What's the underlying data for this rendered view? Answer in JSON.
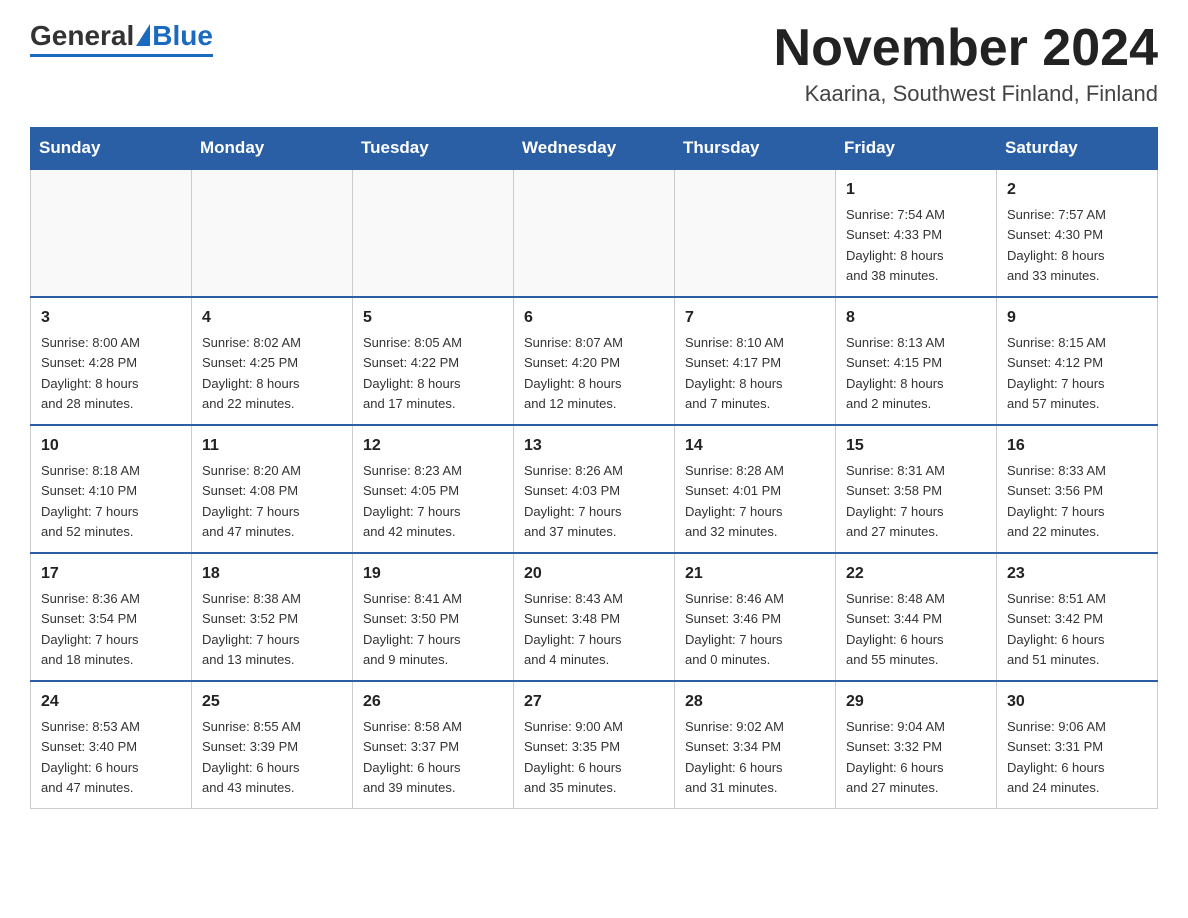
{
  "header": {
    "logo_general": "General",
    "logo_blue": "Blue",
    "month_title": "November 2024",
    "subtitle": "Kaarina, Southwest Finland, Finland"
  },
  "days_of_week": [
    "Sunday",
    "Monday",
    "Tuesday",
    "Wednesday",
    "Thursday",
    "Friday",
    "Saturday"
  ],
  "weeks": [
    [
      {
        "day": "",
        "info": ""
      },
      {
        "day": "",
        "info": ""
      },
      {
        "day": "",
        "info": ""
      },
      {
        "day": "",
        "info": ""
      },
      {
        "day": "",
        "info": ""
      },
      {
        "day": "1",
        "info": "Sunrise: 7:54 AM\nSunset: 4:33 PM\nDaylight: 8 hours\nand 38 minutes."
      },
      {
        "day": "2",
        "info": "Sunrise: 7:57 AM\nSunset: 4:30 PM\nDaylight: 8 hours\nand 33 minutes."
      }
    ],
    [
      {
        "day": "3",
        "info": "Sunrise: 8:00 AM\nSunset: 4:28 PM\nDaylight: 8 hours\nand 28 minutes."
      },
      {
        "day": "4",
        "info": "Sunrise: 8:02 AM\nSunset: 4:25 PM\nDaylight: 8 hours\nand 22 minutes."
      },
      {
        "day": "5",
        "info": "Sunrise: 8:05 AM\nSunset: 4:22 PM\nDaylight: 8 hours\nand 17 minutes."
      },
      {
        "day": "6",
        "info": "Sunrise: 8:07 AM\nSunset: 4:20 PM\nDaylight: 8 hours\nand 12 minutes."
      },
      {
        "day": "7",
        "info": "Sunrise: 8:10 AM\nSunset: 4:17 PM\nDaylight: 8 hours\nand 7 minutes."
      },
      {
        "day": "8",
        "info": "Sunrise: 8:13 AM\nSunset: 4:15 PM\nDaylight: 8 hours\nand 2 minutes."
      },
      {
        "day": "9",
        "info": "Sunrise: 8:15 AM\nSunset: 4:12 PM\nDaylight: 7 hours\nand 57 minutes."
      }
    ],
    [
      {
        "day": "10",
        "info": "Sunrise: 8:18 AM\nSunset: 4:10 PM\nDaylight: 7 hours\nand 52 minutes."
      },
      {
        "day": "11",
        "info": "Sunrise: 8:20 AM\nSunset: 4:08 PM\nDaylight: 7 hours\nand 47 minutes."
      },
      {
        "day": "12",
        "info": "Sunrise: 8:23 AM\nSunset: 4:05 PM\nDaylight: 7 hours\nand 42 minutes."
      },
      {
        "day": "13",
        "info": "Sunrise: 8:26 AM\nSunset: 4:03 PM\nDaylight: 7 hours\nand 37 minutes."
      },
      {
        "day": "14",
        "info": "Sunrise: 8:28 AM\nSunset: 4:01 PM\nDaylight: 7 hours\nand 32 minutes."
      },
      {
        "day": "15",
        "info": "Sunrise: 8:31 AM\nSunset: 3:58 PM\nDaylight: 7 hours\nand 27 minutes."
      },
      {
        "day": "16",
        "info": "Sunrise: 8:33 AM\nSunset: 3:56 PM\nDaylight: 7 hours\nand 22 minutes."
      }
    ],
    [
      {
        "day": "17",
        "info": "Sunrise: 8:36 AM\nSunset: 3:54 PM\nDaylight: 7 hours\nand 18 minutes."
      },
      {
        "day": "18",
        "info": "Sunrise: 8:38 AM\nSunset: 3:52 PM\nDaylight: 7 hours\nand 13 minutes."
      },
      {
        "day": "19",
        "info": "Sunrise: 8:41 AM\nSunset: 3:50 PM\nDaylight: 7 hours\nand 9 minutes."
      },
      {
        "day": "20",
        "info": "Sunrise: 8:43 AM\nSunset: 3:48 PM\nDaylight: 7 hours\nand 4 minutes."
      },
      {
        "day": "21",
        "info": "Sunrise: 8:46 AM\nSunset: 3:46 PM\nDaylight: 7 hours\nand 0 minutes."
      },
      {
        "day": "22",
        "info": "Sunrise: 8:48 AM\nSunset: 3:44 PM\nDaylight: 6 hours\nand 55 minutes."
      },
      {
        "day": "23",
        "info": "Sunrise: 8:51 AM\nSunset: 3:42 PM\nDaylight: 6 hours\nand 51 minutes."
      }
    ],
    [
      {
        "day": "24",
        "info": "Sunrise: 8:53 AM\nSunset: 3:40 PM\nDaylight: 6 hours\nand 47 minutes."
      },
      {
        "day": "25",
        "info": "Sunrise: 8:55 AM\nSunset: 3:39 PM\nDaylight: 6 hours\nand 43 minutes."
      },
      {
        "day": "26",
        "info": "Sunrise: 8:58 AM\nSunset: 3:37 PM\nDaylight: 6 hours\nand 39 minutes."
      },
      {
        "day": "27",
        "info": "Sunrise: 9:00 AM\nSunset: 3:35 PM\nDaylight: 6 hours\nand 35 minutes."
      },
      {
        "day": "28",
        "info": "Sunrise: 9:02 AM\nSunset: 3:34 PM\nDaylight: 6 hours\nand 31 minutes."
      },
      {
        "day": "29",
        "info": "Sunrise: 9:04 AM\nSunset: 3:32 PM\nDaylight: 6 hours\nand 27 minutes."
      },
      {
        "day": "30",
        "info": "Sunrise: 9:06 AM\nSunset: 3:31 PM\nDaylight: 6 hours\nand 24 minutes."
      }
    ]
  ]
}
